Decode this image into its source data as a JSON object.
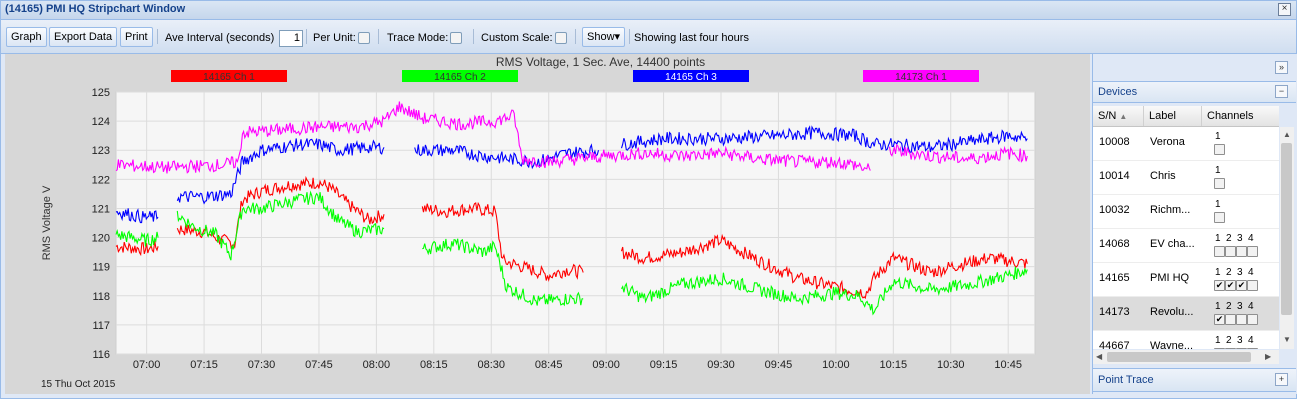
{
  "window": {
    "title": "(14165) PMI HQ Stripchart Window",
    "close_glyph": "×"
  },
  "toolbar": {
    "graph": "Graph",
    "export": "Export Data",
    "print": "Print",
    "ave_interval_label": "Ave Interval (seconds)",
    "ave_interval_value": "1",
    "per_unit": "Per Unit:",
    "trace_mode": "Trace Mode:",
    "custom_scale": "Custom Scale:",
    "show": "Show",
    "show_arrow": "▾",
    "status": "Showing last four hours"
  },
  "side": {
    "expand_glyph": "»",
    "devices_title": "Devices",
    "collapse_glyph": "−",
    "point_trace_title": "Point Trace",
    "plus_glyph": "+",
    "columns": {
      "sn": "S/N",
      "sort_glyph": "▲",
      "label": "Label",
      "channels": "Channels"
    },
    "devices": [
      {
        "sn": "10008",
        "label": "Verona",
        "channels": [
          "1"
        ],
        "checked": [
          false
        ],
        "selected": false
      },
      {
        "sn": "10014",
        "label": "Chris",
        "channels": [
          "1"
        ],
        "checked": [
          false
        ],
        "selected": false
      },
      {
        "sn": "10032",
        "label": "Richm...",
        "channels": [
          "1"
        ],
        "checked": [
          false
        ],
        "selected": false
      },
      {
        "sn": "14068",
        "label": "EV cha...",
        "channels": [
          "1",
          "2",
          "3",
          "4"
        ],
        "checked": [
          false,
          false,
          false,
          false
        ],
        "selected": false
      },
      {
        "sn": "14165",
        "label": "PMI HQ",
        "channels": [
          "1",
          "2",
          "3",
          "4"
        ],
        "checked": [
          true,
          true,
          true,
          false
        ],
        "selected": false
      },
      {
        "sn": "14173",
        "label": "Revolu...",
        "channels": [
          "1",
          "2",
          "3",
          "4"
        ],
        "checked": [
          true,
          false,
          false,
          false
        ],
        "selected": true
      },
      {
        "sn": "44667",
        "label": "Wayne...",
        "channels": [
          "1",
          "2",
          "3",
          "4"
        ],
        "checked": [
          false,
          false,
          false,
          false
        ],
        "selected": false
      }
    ],
    "check_glyph": "✔"
  },
  "chart_data": {
    "type": "line",
    "title": "RMS Voltage, 1 Sec. Ave, 14400 points",
    "ylabel": "RMS Voltage V",
    "date_label": "15 Thu Oct 2015",
    "ylim": [
      116,
      125
    ],
    "yticks": [
      116,
      117,
      118,
      119,
      120,
      121,
      122,
      123,
      124,
      125
    ],
    "xlim": [
      "06:52",
      "10:52"
    ],
    "xticks": [
      "07:00",
      "07:15",
      "07:30",
      "07:45",
      "08:00",
      "08:15",
      "08:30",
      "08:45",
      "09:00",
      "09:15",
      "09:30",
      "09:45",
      "10:00",
      "10:15",
      "10:30",
      "10:45"
    ],
    "grid": true,
    "legend_position": "top",
    "series": [
      {
        "name": "14165 Ch 1",
        "color": "#ff0000",
        "segments": [
          [
            [
              "06:52",
              119.7
            ],
            [
              "07:00",
              119.6
            ],
            [
              "07:03",
              119.7
            ]
          ],
          [
            [
              "07:08",
              120.3
            ],
            [
              "07:15",
              120.2
            ],
            [
              "07:20",
              119.9
            ],
            [
              "07:23",
              119.8
            ],
            [
              "07:25",
              121.3
            ],
            [
              "07:30",
              121.6
            ],
            [
              "07:37",
              121.8
            ],
            [
              "07:45",
              121.9
            ],
            [
              "07:48",
              121.7
            ],
            [
              "07:53",
              121.1
            ],
            [
              "07:58",
              120.6
            ],
            [
              "08:02",
              120.8
            ]
          ],
          [
            [
              "08:12",
              121.0
            ],
            [
              "08:18",
              120.9
            ],
            [
              "08:25",
              121.0
            ],
            [
              "08:31",
              120.9
            ],
            [
              "08:33",
              119.2
            ],
            [
              "08:38",
              119.0
            ],
            [
              "08:45",
              118.7
            ],
            [
              "08:50",
              118.9
            ],
            [
              "08:54",
              118.8
            ]
          ],
          [
            [
              "09:04",
              119.5
            ],
            [
              "09:10",
              119.3
            ],
            [
              "09:20",
              119.5
            ],
            [
              "09:30",
              119.9
            ],
            [
              "09:40",
              119.2
            ],
            [
              "09:50",
              118.6
            ],
            [
              "10:00",
              118.3
            ],
            [
              "10:08",
              118.1
            ],
            [
              "10:10",
              118.6
            ],
            [
              "10:15",
              119.3
            ],
            [
              "10:25",
              118.8
            ],
            [
              "10:30",
              119.0
            ],
            [
              "10:40",
              119.3
            ],
            [
              "10:50",
              119.1
            ]
          ]
        ]
      },
      {
        "name": "14165 Ch 2",
        "color": "#00ff00",
        "segments": [
          [
            [
              "06:52",
              120.1
            ],
            [
              "07:00",
              119.9
            ],
            [
              "07:03",
              120.0
            ]
          ],
          [
            [
              "07:08",
              120.8
            ],
            [
              "07:12",
              120.4
            ],
            [
              "07:18",
              120.1
            ],
            [
              "07:22",
              119.4
            ],
            [
              "07:25",
              121.0
            ],
            [
              "07:30",
              121.0
            ],
            [
              "07:40",
              121.3
            ],
            [
              "07:45",
              121.4
            ],
            [
              "07:50",
              120.6
            ],
            [
              "07:55",
              120.2
            ],
            [
              "08:02",
              120.3
            ]
          ],
          [
            [
              "08:12",
              119.6
            ],
            [
              "08:20",
              119.8
            ],
            [
              "08:28",
              119.5
            ],
            [
              "08:31",
              119.7
            ],
            [
              "08:34",
              118.3
            ],
            [
              "08:42",
              117.8
            ],
            [
              "08:50",
              117.9
            ],
            [
              "08:54",
              117.9
            ]
          ],
          [
            [
              "09:04",
              118.3
            ],
            [
              "09:10",
              117.9
            ],
            [
              "09:20",
              118.4
            ],
            [
              "09:30",
              118.6
            ],
            [
              "09:40",
              118.2
            ],
            [
              "09:50",
              117.9
            ],
            [
              "10:00",
              118.1
            ],
            [
              "10:06",
              118.0
            ],
            [
              "10:10",
              117.5
            ],
            [
              "10:15",
              118.5
            ],
            [
              "10:25",
              118.2
            ],
            [
              "10:35",
              118.4
            ],
            [
              "10:45",
              118.7
            ],
            [
              "10:50",
              118.9
            ]
          ]
        ]
      },
      {
        "name": "14165 Ch 3",
        "color": "#0000ff",
        "segments": [
          [
            [
              "06:52",
              120.9
            ],
            [
              "06:59",
              120.7
            ],
            [
              "07:03",
              120.7
            ]
          ],
          [
            [
              "07:08",
              121.4
            ],
            [
              "07:15",
              121.4
            ],
            [
              "07:22",
              121.5
            ],
            [
              "07:25",
              122.6
            ],
            [
              "07:30",
              123.0
            ],
            [
              "07:40",
              123.2
            ],
            [
              "07:45",
              123.2
            ],
            [
              "07:50",
              123.0
            ],
            [
              "07:58",
              123.1
            ],
            [
              "08:02",
              123.1
            ]
          ],
          [
            [
              "08:10",
              123.0
            ],
            [
              "08:20",
              123.0
            ],
            [
              "08:28",
              122.8
            ],
            [
              "08:35",
              122.7
            ],
            [
              "08:42",
              122.6
            ],
            [
              "08:50",
              122.9
            ],
            [
              "08:58",
              123.0
            ]
          ],
          [
            [
              "09:04",
              123.2
            ],
            [
              "09:15",
              123.4
            ],
            [
              "09:30",
              123.4
            ],
            [
              "09:45",
              123.5
            ],
            [
              "09:55",
              123.6
            ],
            [
              "10:05",
              123.5
            ],
            [
              "10:10",
              123.2
            ],
            [
              "10:15",
              123.2
            ],
            [
              "10:25",
              123.1
            ],
            [
              "10:35",
              123.3
            ],
            [
              "10:45",
              123.5
            ],
            [
              "10:50",
              123.4
            ]
          ]
        ]
      },
      {
        "name": "14173 Ch 1",
        "color": "#ff00ff",
        "segments": [
          [
            [
              "06:52",
              122.5
            ],
            [
              "07:05",
              122.4
            ],
            [
              "07:20",
              122.5
            ],
            [
              "07:24",
              122.6
            ],
            [
              "07:25",
              123.6
            ],
            [
              "07:35",
              123.7
            ],
            [
              "07:45",
              123.8
            ],
            [
              "07:55",
              123.8
            ],
            [
              "08:02",
              124.0
            ],
            [
              "08:06",
              124.5
            ],
            [
              "08:12",
              124.1
            ],
            [
              "08:22",
              123.9
            ],
            [
              "08:31",
              124.0
            ],
            [
              "08:36",
              124.2
            ],
            [
              "08:38",
              122.7
            ],
            [
              "08:45",
              122.6
            ],
            [
              "08:52",
              122.7
            ],
            [
              "09:00",
              122.8
            ],
            [
              "09:10",
              122.9
            ],
            [
              "09:20",
              122.8
            ],
            [
              "09:30",
              122.9
            ],
            [
              "09:40",
              122.7
            ],
            [
              "09:50",
              122.6
            ],
            [
              "10:00",
              122.6
            ],
            [
              "10:05",
              122.5
            ],
            [
              "10:09",
              122.3
            ]
          ],
          [
            [
              "10:14",
              123.0
            ],
            [
              "10:25",
              122.8
            ],
            [
              "10:35",
              122.7
            ],
            [
              "10:45",
              122.9
            ],
            [
              "10:50",
              122.8
            ]
          ]
        ]
      }
    ]
  }
}
